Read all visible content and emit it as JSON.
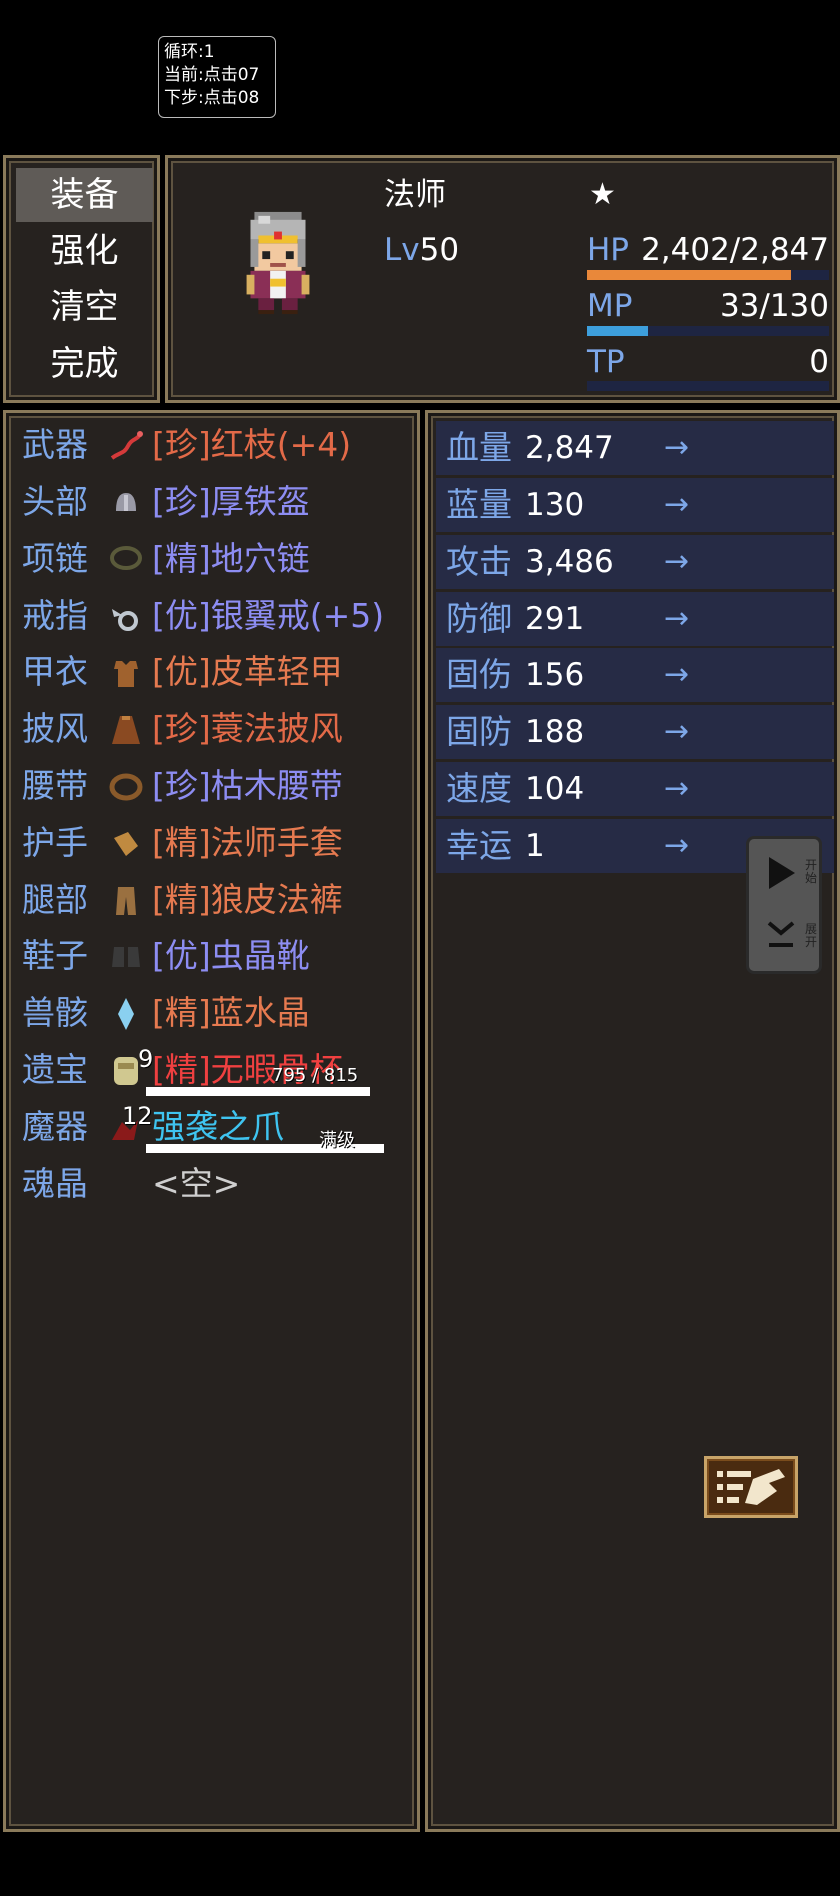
{
  "overlay": {
    "line1": "循环:1",
    "line2": "当前:点击07",
    "line3": "下步:点击08"
  },
  "menu": {
    "items": [
      {
        "label": "装备",
        "selected": true
      },
      {
        "label": "强化",
        "selected": false
      },
      {
        "label": "清空",
        "selected": false
      },
      {
        "label": "完成",
        "selected": false
      }
    ]
  },
  "status": {
    "class_name": "法师",
    "star": "★",
    "level_label": "Lv",
    "level_value": "50",
    "hp_label": "HP",
    "hp_value": "2,402/2,847",
    "hp_ratio": 0.844,
    "mp_label": "MP",
    "mp_value": "33/130",
    "mp_ratio": 0.254,
    "tp_label": "TP",
    "tp_value": "0",
    "tp_ratio": 0,
    "colors": {
      "hp": "#e9883a",
      "mp": "#3d9fdc",
      "bar_bg": "#1e2542"
    }
  },
  "equipment": {
    "slots": [
      {
        "slot": "武器",
        "name": "[珍]红枝(+4)",
        "icon": "red-branch-icon"
      },
      {
        "slot": "头部",
        "name": "[珍]厚铁盔",
        "icon": "iron-helmet-icon"
      },
      {
        "slot": "项链",
        "name": "[精]地穴链",
        "icon": "necklace-icon"
      },
      {
        "slot": "戒指",
        "name": "[优]银翼戒(+5)",
        "icon": "silver-wing-ring-icon"
      },
      {
        "slot": "甲衣",
        "name": "[优]皮革轻甲",
        "icon": "leather-armor-icon"
      },
      {
        "slot": "披风",
        "name": "[珍]蓑法披风",
        "icon": "cloak-icon"
      },
      {
        "slot": "腰带",
        "name": "[珍]枯木腰带",
        "icon": "belt-icon"
      },
      {
        "slot": "护手",
        "name": "[精]法师手套",
        "icon": "gloves-icon"
      },
      {
        "slot": "腿部",
        "name": "[精]狼皮法裤",
        "icon": "pants-icon"
      },
      {
        "slot": "鞋子",
        "name": "[优]虫晶靴",
        "icon": "boots-icon"
      },
      {
        "slot": "兽骸",
        "name": "[精]蓝水晶",
        "icon": "blue-crystal-icon"
      },
      {
        "slot": "遗宝",
        "name": "[精]无暇骨杯",
        "icon": "bone-cup-icon",
        "badge": "9",
        "progress_text": "795 / 815",
        "progress_ratio": 0.975
      },
      {
        "slot": "魔器",
        "name": "强袭之爪",
        "icon": "claw-icon",
        "badge": "12",
        "progress_text": "满级",
        "progress_ratio": 1.0
      },
      {
        "slot": "魂晶",
        "name": "<空>",
        "icon": ""
      }
    ]
  },
  "stats": {
    "arrow": "→",
    "rows": [
      {
        "label": "血量",
        "value": "2,847"
      },
      {
        "label": "蓝量",
        "value": "130"
      },
      {
        "label": "攻击",
        "value": "3,486"
      },
      {
        "label": "防御",
        "value": "291"
      },
      {
        "label": "固伤",
        "value": "156"
      },
      {
        "label": "固防",
        "value": "188"
      },
      {
        "label": "速度",
        "value": "104"
      },
      {
        "label": "幸运",
        "value": "1"
      }
    ]
  },
  "side_control": {
    "play_label": "开始",
    "expand_label": "展开"
  }
}
